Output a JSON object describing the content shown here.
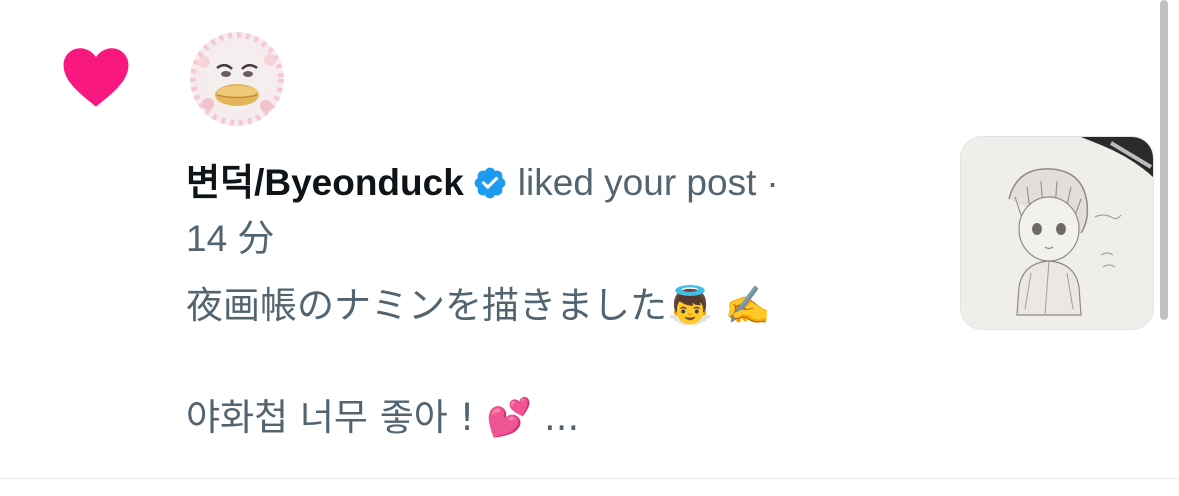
{
  "notification": {
    "type_icon": "heart-icon",
    "user_name": "변덕/Byeonduck",
    "verified_icon": "verified-badge-icon",
    "action_text": "liked your post",
    "separator": "·",
    "timestamp": "14 分",
    "post_line1": "夜画帳のナミンを描きました👼 ✍️",
    "post_line2": "야화첩 너무 좋아 ! 💕 ...",
    "avatar": "user-avatar",
    "thumbnail": "post-thumbnail-pencil-drawing"
  },
  "colors": {
    "heart": "#f91880",
    "verified": "#1d9bf0",
    "secondary_text": "#536471",
    "primary_text": "#0f1419"
  }
}
